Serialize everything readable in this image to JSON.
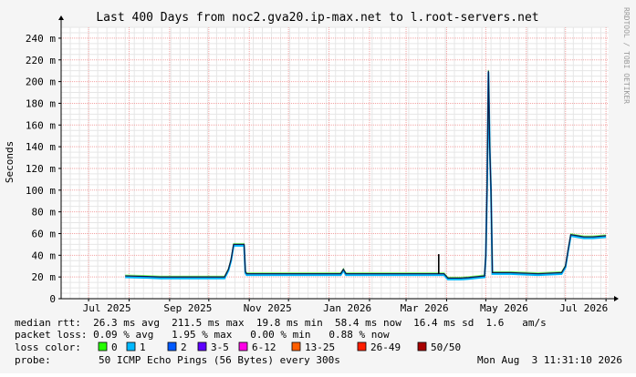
{
  "chart_data": {
    "type": "line",
    "title": "Last 400 Days from noc2.gva20.ip-max.net to l.root-servers.net",
    "ylabel": "Seconds",
    "watermark": "RRDTOOL / TOBI OETIKER",
    "ylim": [
      0,
      250
    ],
    "yticks": [
      {
        "v": 0,
        "label": "0"
      },
      {
        "v": 20,
        "label": "20 m"
      },
      {
        "v": 40,
        "label": "40 m"
      },
      {
        "v": 60,
        "label": "60 m"
      },
      {
        "v": 80,
        "label": "80 m"
      },
      {
        "v": 100,
        "label": "100 m"
      },
      {
        "v": 120,
        "label": "120 m"
      },
      {
        "v": 140,
        "label": "140 m"
      },
      {
        "v": 160,
        "label": "160 m"
      },
      {
        "v": 180,
        "label": "180 m"
      },
      {
        "v": 200,
        "label": "200 m"
      },
      {
        "v": 220,
        "label": "220 m"
      },
      {
        "v": 240,
        "label": "240 m"
      }
    ],
    "xlim": [
      "2025-06-10",
      "2026-08-03"
    ],
    "xticks": [
      {
        "date": "2025-07-15",
        "label": "Jul 2025"
      },
      {
        "date": "2025-09-15",
        "label": "Sep 2025"
      },
      {
        "date": "2025-11-15",
        "label": "Nov 2025"
      },
      {
        "date": "2026-01-15",
        "label": "Jan 2026"
      },
      {
        "date": "2026-03-15",
        "label": "Mar 2026"
      },
      {
        "date": "2026-05-15",
        "label": "May 2026"
      },
      {
        "date": "2026-07-15",
        "label": "Jul 2026"
      }
    ],
    "series": [
      {
        "name": "median rtt",
        "color": "#0d1a4d",
        "points": [
          [
            "2025-07-29",
            21
          ],
          [
            "2025-08-15",
            20.5
          ],
          [
            "2025-08-25",
            20
          ],
          [
            "2025-09-15",
            20
          ],
          [
            "2025-10-13",
            20
          ],
          [
            "2025-10-16",
            27
          ],
          [
            "2025-10-18",
            36
          ],
          [
            "2025-10-20",
            50
          ],
          [
            "2025-10-28",
            50
          ],
          [
            "2025-10-29",
            25
          ],
          [
            "2025-10-30",
            23
          ],
          [
            "2025-12-15",
            23
          ],
          [
            "2026-01-10",
            23
          ],
          [
            "2026-01-12",
            27
          ],
          [
            "2026-01-14",
            23
          ],
          [
            "2026-03-20",
            23
          ],
          [
            "2026-03-30",
            23
          ],
          [
            "2026-04-02",
            19
          ],
          [
            "2026-04-12",
            19
          ],
          [
            "2026-04-18",
            19.5
          ],
          [
            "2026-04-30",
            21
          ],
          [
            "2026-05-01",
            40
          ],
          [
            "2026-05-02",
            104
          ],
          [
            "2026-05-03",
            210
          ],
          [
            "2026-05-04",
            140
          ],
          [
            "2026-05-05",
            100
          ],
          [
            "2026-05-06",
            24
          ],
          [
            "2026-05-20",
            24
          ],
          [
            "2026-06-10",
            23
          ],
          [
            "2026-06-28",
            24
          ],
          [
            "2026-07-01",
            30
          ],
          [
            "2026-07-03",
            45
          ],
          [
            "2026-07-05",
            59
          ],
          [
            "2026-07-15",
            57
          ],
          [
            "2026-07-22",
            57
          ],
          [
            "2026-08-01",
            58
          ]
        ]
      },
      {
        "name": "spike",
        "color": "#000000",
        "points": [
          [
            "2026-03-26",
            23
          ],
          [
            "2026-03-26",
            41
          ]
        ]
      }
    ]
  },
  "legend": {
    "median_line": "median rtt:  26.3 ms avg  211.5 ms max  19.8 ms min  58.4 ms now  16.4 ms sd  1.6   am/s",
    "loss_line": "packet loss: 0.09 % avg   1.95 % max   0.00 % min   0.88 % now",
    "loss_label": "loss color:",
    "loss_items": [
      {
        "label": "0",
        "color": "#26ff00"
      },
      {
        "label": "1",
        "color": "#00b8ff"
      },
      {
        "label": "2",
        "color": "#0059ff"
      },
      {
        "label": "3-5",
        "color": "#5e00ff"
      },
      {
        "label": "6-12",
        "color": "#ff00e6"
      },
      {
        "label": "13-25",
        "color": "#ff5e00"
      },
      {
        "label": "26-49",
        "color": "#ff1e00"
      },
      {
        "label": "50/50",
        "color": "#a70000"
      }
    ],
    "probe_label": "probe:",
    "probe_desc": "50 ICMP Echo Pings (56 Bytes) every 300s",
    "timestamp": "Mon Aug  3 11:31:10 2026"
  }
}
